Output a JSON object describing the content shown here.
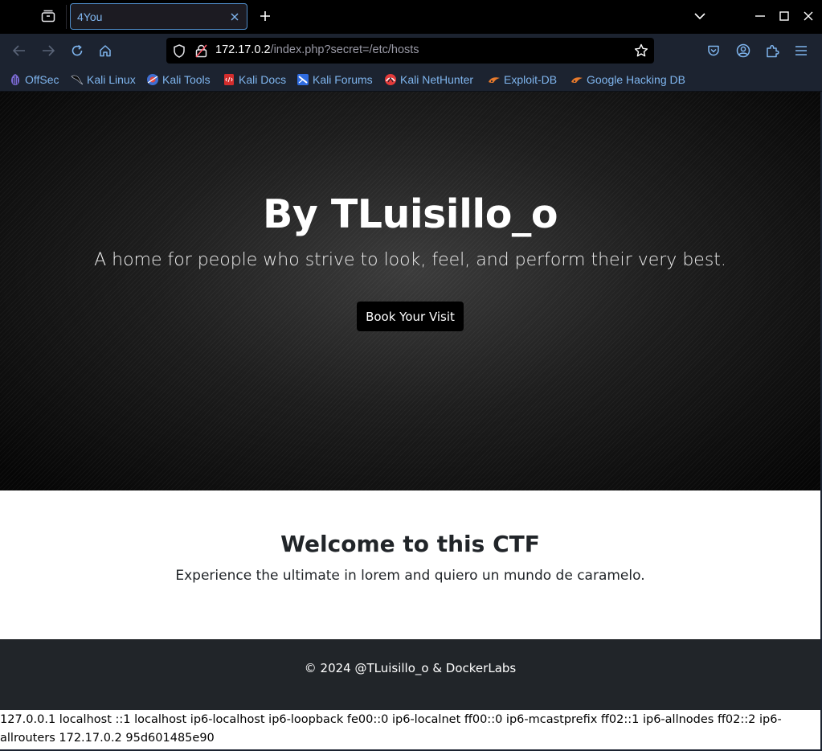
{
  "browser": {
    "tab_title": "4You",
    "url_host": "172.17.0.2",
    "url_path": "/index.php?secret=/etc/hosts",
    "accent": "#7fb5ee"
  },
  "bookmarks": [
    {
      "label": "OffSec",
      "icon": "offsec-icon"
    },
    {
      "label": "Kali Linux",
      "icon": "kali-dragon-icon"
    },
    {
      "label": "Kali Tools",
      "icon": "kali-tools-icon"
    },
    {
      "label": "Kali Docs",
      "icon": "kali-docs-icon"
    },
    {
      "label": "Kali Forums",
      "icon": "kali-forums-icon"
    },
    {
      "label": "Kali NetHunter",
      "icon": "nethunter-icon"
    },
    {
      "label": "Exploit-DB",
      "icon": "exploit-db-icon"
    },
    {
      "label": "Google Hacking DB",
      "icon": "ghdb-icon"
    }
  ],
  "hero": {
    "title": "By TLuisillo_o",
    "subtitle": "A home for people who strive to look, feel, and perform their very best.",
    "button_label": "Book Your Visit"
  },
  "welcome": {
    "heading": "Welcome to this CTF",
    "text": "Experience the ultimate in lorem and quiero un mundo de caramelo."
  },
  "footer": {
    "text": "© 2024 @TLuisillo_o & DockerLabs"
  },
  "hosts_output": "127.0.0.1 localhost ::1 localhost ip6-localhost ip6-loopback fe00::0 ip6-localnet ff00::0 ip6-mcastprefix ff02::1 ip6-allnodes ff02::2 ip6-allrouters 172.17.0.2 95d601485e90"
}
